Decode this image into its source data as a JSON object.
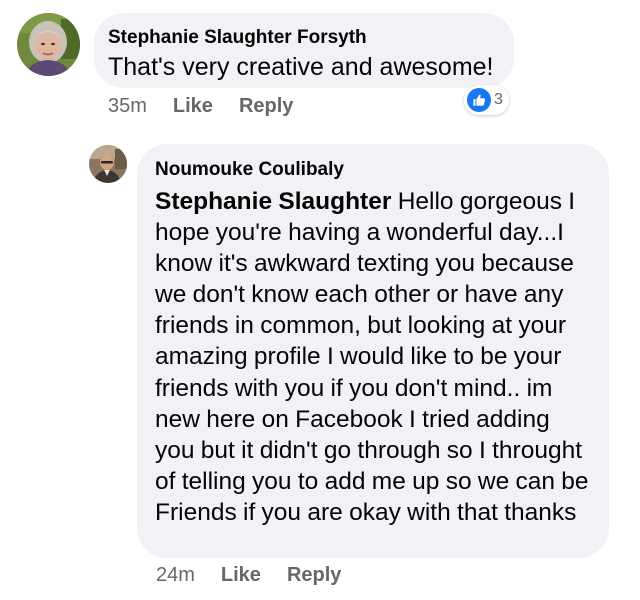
{
  "comment": {
    "author": "Stephanie Slaughter Forsyth",
    "text": "That's very creative and awesome!",
    "time": "35m",
    "like_label": "Like",
    "reply_label": "Reply",
    "reaction_count": "3",
    "reaction_icon": "thumbs-up-icon",
    "accent_color": "#1877f2"
  },
  "reply": {
    "author": "Noumouke Coulibaly",
    "mention": "Stephanie Slaughter",
    "text": " Hello gorgeous I hope you're having a wonderful day...I know it's awkward texting you because we don't know each other or have any friends in common, but looking at your amazing profile I would like to be your friends with you if you don't mind.. im new here on Facebook I tried adding you but it didn't go through so I throught of telling you to add me up so we can be Friends if you are okay with that thanks",
    "time": "24m",
    "like_label": "Like",
    "reply_label": "Reply"
  },
  "colors": {
    "bubble_bg": "#f0f2f5",
    "secondary_text": "#65676b",
    "primary_text": "#050505"
  }
}
